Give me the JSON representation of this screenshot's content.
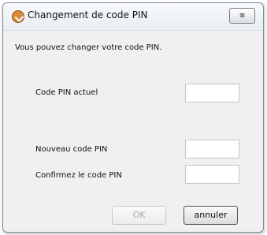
{
  "dialog": {
    "title": "Changement de code PIN",
    "close_symbol": "⌧",
    "instruction": "Vous pouvez changer votre code PIN.",
    "fields": [
      {
        "label": "Code PIN actuel",
        "value": ""
      },
      {
        "label": "Nouveau code PIN",
        "value": ""
      },
      {
        "label": "Confirmez le code PIN",
        "value": ""
      }
    ],
    "buttons": {
      "ok": "OK",
      "cancel": "annuler"
    }
  }
}
